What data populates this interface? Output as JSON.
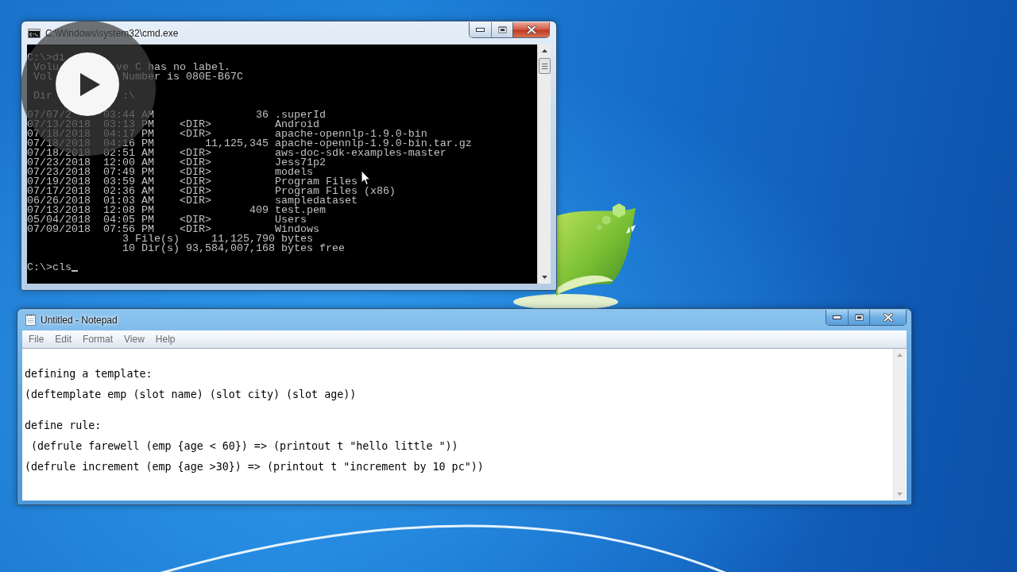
{
  "console_window": {
    "title": "C:\\Windows\\system32\\cmd.exe",
    "active": true,
    "header_blocks": [
      [
        [
          "C:\\>di"
        ],
        [
          "Volu",
          "ve C has no label."
        ],
        [
          "Vol",
          "Number is 080E-B67C"
        ]
      ],
      [
        [
          "Dir",
          ":\\"
        ]
      ]
    ],
    "listing": [
      {
        "kind": "file",
        "date": "07/07/2",
        "time": "03:44 AM",
        "size": "36",
        "name": ".superId"
      },
      {
        "kind": "dir",
        "date": "07/13/2018",
        "time": "03:13 PM",
        "tag": "<DIR>",
        "name": "Android"
      },
      {
        "kind": "dir",
        "date": "07/18/2018",
        "time": "04:17 PM",
        "tag": "<DIR>",
        "name": "apache-opennlp-1.9.0-bin"
      },
      {
        "kind": "file",
        "date": "07/18/2018",
        "time": "04:16 PM",
        "size": "11,125,345",
        "name": "apache-opennlp-1.9.0-bin.tar.gz"
      },
      {
        "kind": "dir",
        "date": "07/18/2018",
        "time": "02:51 AM",
        "tag": "<DIR>",
        "name": "aws-doc-sdk-examples-master"
      },
      {
        "kind": "dir",
        "date": "07/23/2018",
        "time": "12:00 AM",
        "tag": "<DIR>",
        "name": "Jess71p2"
      },
      {
        "kind": "dir",
        "date": "07/23/2018",
        "time": "07:49 PM",
        "tag": "<DIR>",
        "name": "models"
      },
      {
        "kind": "dir",
        "date": "07/19/2018",
        "time": "03:59 AM",
        "tag": "<DIR>",
        "name": "Program Files"
      },
      {
        "kind": "dir",
        "date": "07/17/2018",
        "time": "02:36 AM",
        "tag": "<DIR>",
        "name": "Program Files (x86)"
      },
      {
        "kind": "dir",
        "date": "06/26/2018",
        "time": "01:03 AM",
        "tag": "<DIR>",
        "name": "sampledataset"
      },
      {
        "kind": "file",
        "date": "07/13/2018",
        "time": "12:08 PM",
        "size": "409",
        "name": "test.pem"
      },
      {
        "kind": "dir",
        "date": "05/04/2018",
        "time": "04:05 PM",
        "tag": "<DIR>",
        "name": "Users"
      },
      {
        "kind": "dir",
        "date": "07/09/2018",
        "time": "07:56 PM",
        "tag": "<DIR>",
        "name": "Windows"
      }
    ],
    "summary": [
      {
        "count": "3 File(s)",
        "size": "11,125,790",
        "unit": "bytes"
      },
      {
        "count": "10 Dir(s)",
        "size": "93,584,007,168",
        "unit": "bytes free"
      }
    ],
    "prompt": "C:\\>cls"
  },
  "notepad_window": {
    "title": "Untitled - Notepad",
    "active": false,
    "menu": [
      "File",
      "Edit",
      "Format",
      "View",
      "Help"
    ],
    "blocks": [
      [
        "defining a template:",
        "(deftemplate emp (slot name) (slot city) (slot age))"
      ],
      [
        "define rule:",
        " (defrule farewell (emp {age < 60}) => (printout t \"hello little \"))",
        "(defrule increment (emp {age >30}) => (printout t \"increment by 10 pc\"))"
      ]
    ]
  }
}
